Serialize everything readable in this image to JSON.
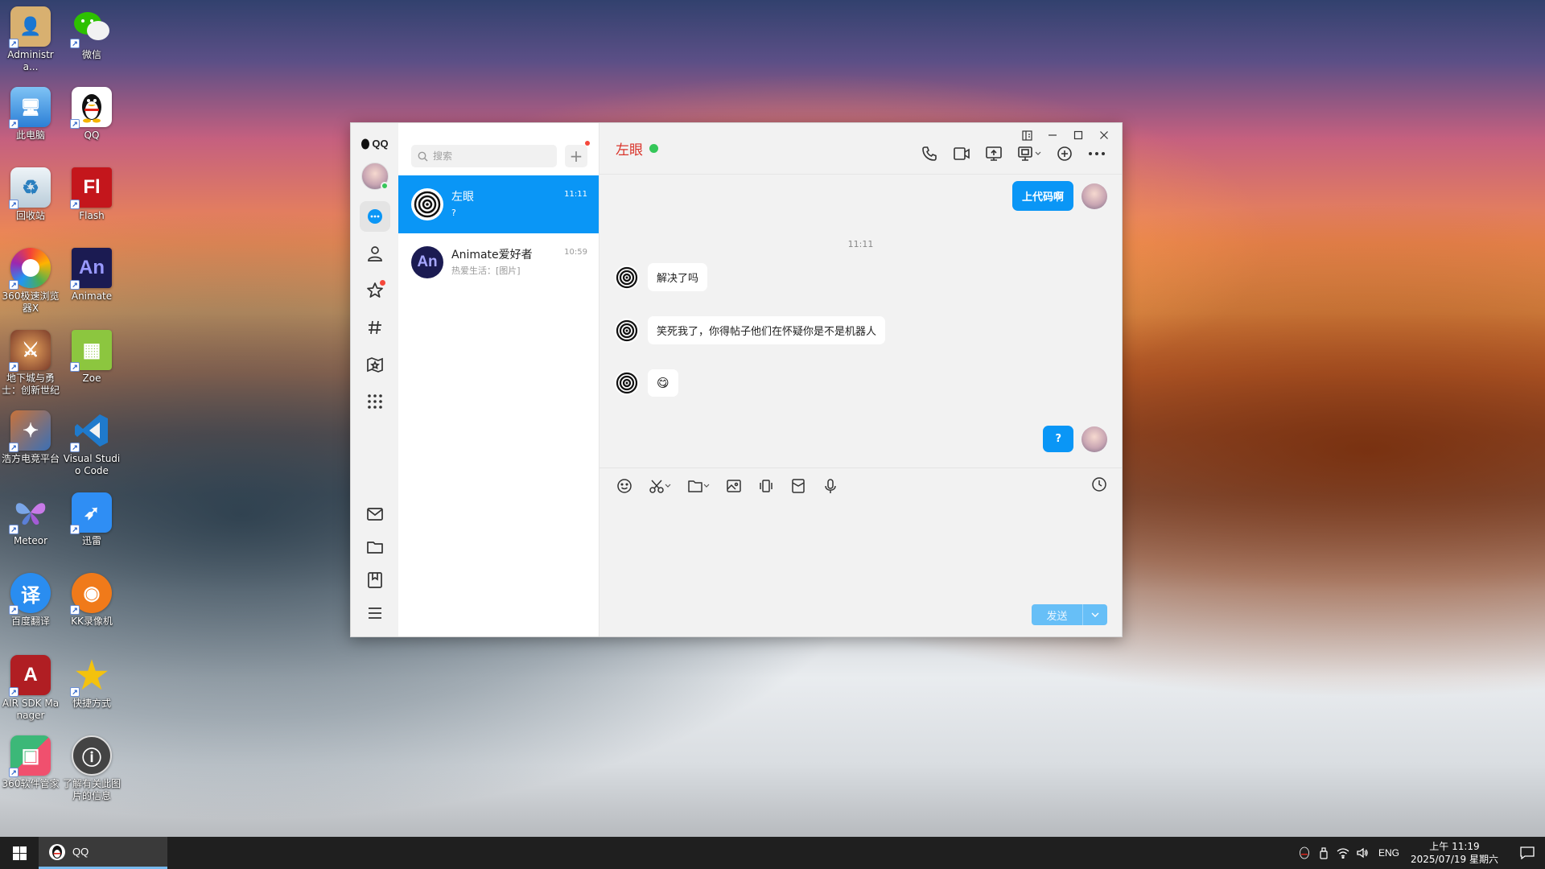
{
  "desktop": {
    "icons": [
      {
        "label": "Administra...",
        "glyph": "👤",
        "bg": "#d8b070"
      },
      {
        "label": "微信",
        "glyph": "●●",
        "bg": "#ffffff"
      },
      {
        "label": "此电脑",
        "glyph": "▭",
        "bg": "#4fa3e8"
      },
      {
        "label": "QQ",
        "glyph": "🐧",
        "bg": "#ffffff"
      },
      {
        "label": "回收站",
        "glyph": "♻",
        "bg": "#d9e6ef"
      },
      {
        "label": "Flash",
        "glyph": "Fl",
        "bg": "#c4161c"
      },
      {
        "label": "360极速浏览器X",
        "glyph": "◎",
        "bg": "#f7a11a"
      },
      {
        "label": "Animate",
        "glyph": "An",
        "bg": "#1b1b52"
      },
      {
        "label": "地下城与勇士：创新世纪",
        "glyph": "⚔",
        "bg": "#7a3b2a"
      },
      {
        "label": "Zoe",
        "glyph": "▦",
        "bg": "#8cc63f"
      },
      {
        "label": "浩方电竞平台",
        "glyph": "✦",
        "bg": "#3b6fb5"
      },
      {
        "label": "Visual Studio Code",
        "glyph": "⟩",
        "bg": "#1f7acc"
      },
      {
        "label": "Meteor",
        "glyph": "🦋",
        "bg": "#7d4fb4"
      },
      {
        "label": "迅雷",
        "glyph": "➶",
        "bg": "#2f8ef4"
      },
      {
        "label": "百度翻译",
        "glyph": "译",
        "bg": "#2a8df0"
      },
      {
        "label": "KK录像机",
        "glyph": "◉",
        "bg": "#f07a1a"
      },
      {
        "label": "AIR SDK Manager",
        "glyph": "A",
        "bg": "#b01e23"
      },
      {
        "label": "快捷方式",
        "glyph": "★",
        "bg": "#f4c20d"
      },
      {
        "label": "360软件管家",
        "glyph": "▣",
        "bg": "#3cb878"
      },
      {
        "label": "了解有关此图片的信息",
        "glyph": "ⓘ",
        "bg": "#444444"
      }
    ]
  },
  "qq": {
    "brand": "QQ",
    "search_placeholder": "搜索",
    "add_label": "+",
    "conversations": [
      {
        "name": "左眼",
        "preview": "?",
        "time": "11:11",
        "active": true
      },
      {
        "name": "Animate爱好者",
        "preview": "热爱生活：[图片]",
        "time": "10:59",
        "active": false
      }
    ],
    "chat": {
      "title": "左眼",
      "timestamp": "11:11",
      "messages": [
        {
          "dir": "out",
          "text": "上代码啊"
        },
        {
          "dir": "in",
          "text": "解决了吗"
        },
        {
          "dir": "in",
          "text": "笑死我了，你得帖子他们在怀疑你是不是机器人"
        },
        {
          "dir": "in",
          "text": "😋"
        },
        {
          "dir": "out",
          "text": "?"
        }
      ],
      "send_label": "发送"
    }
  },
  "taskbar": {
    "app_label": "QQ",
    "lang": "ENG",
    "time": "上午 11:19",
    "date": "2025/07/19 星期六"
  },
  "colors": {
    "accent": "#0a96f6",
    "online": "#35c759",
    "title_red": "#d9342b",
    "badge_red": "#f5483b"
  }
}
